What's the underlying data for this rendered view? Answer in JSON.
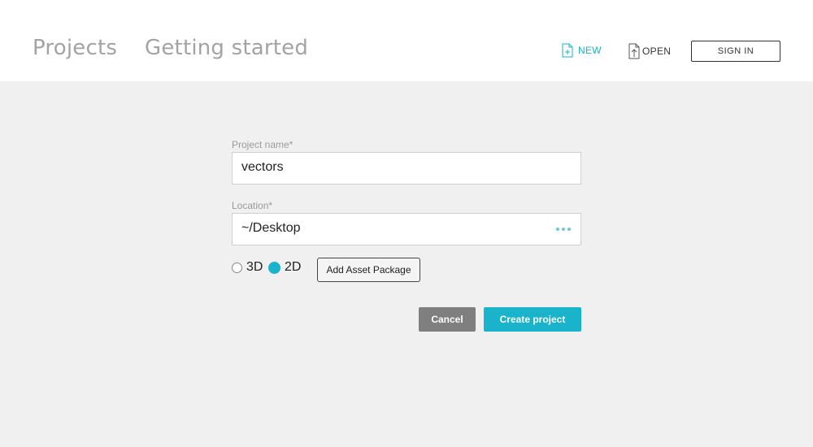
{
  "header": {
    "tabs": [
      {
        "label": "Projects"
      },
      {
        "label": "Getting started"
      }
    ],
    "new_label": "NEW",
    "open_label": "OPEN",
    "signin_label": "SIGN IN"
  },
  "form": {
    "name_label": "Project name*",
    "name_value": "vectors",
    "location_label": "Location*",
    "location_value": "~/Desktop",
    "mode_options": [
      {
        "label": "3D",
        "checked": false
      },
      {
        "label": "2D",
        "checked": true
      }
    ],
    "asset_label": "Add Asset Package",
    "cancel_label": "Cancel",
    "create_label": "Create project"
  },
  "colors": {
    "accent": "#1ab3cc",
    "cancel": "#7f7f7f",
    "background": "#f0f0f0"
  },
  "icons": {
    "new": "new-file-icon",
    "open": "open-file-icon",
    "browse": "more-dots-icon"
  }
}
